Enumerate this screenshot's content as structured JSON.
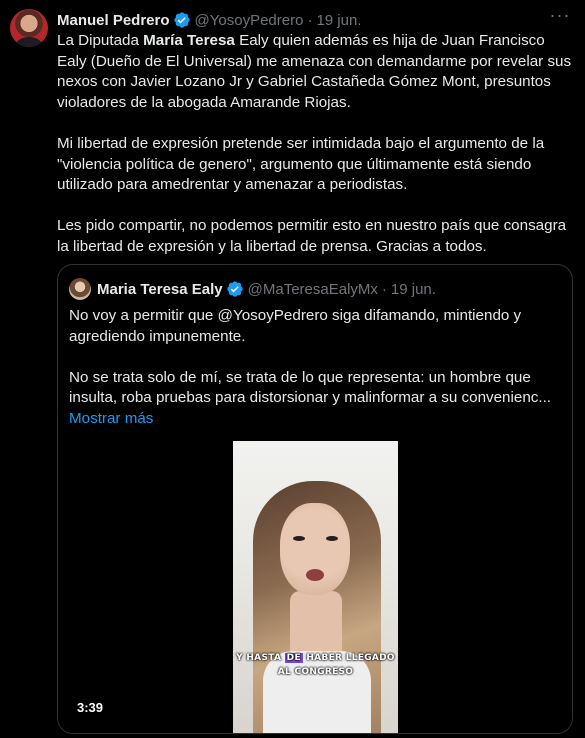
{
  "tweet": {
    "author": {
      "name": "Manuel Pedrero",
      "handle": "@YosoyPedrero",
      "date": "19 jun.",
      "separator": "·"
    },
    "more_label": "···",
    "paragraph1": {
      "t1": "La Diputada ",
      "bold1": "María Teresa",
      "t2": " Ealy quien además es hija de Juan Francisco Ealy (Dueño de El Universal) me amenaza con demandarme por revelar sus nexos con Javier Lozano Jr y Gabriel Castañeda Gómez Mont, presuntos violadores de la abogada Amarande Riojas."
    },
    "paragraph2": "Mi libertad de expresión pretende ser intimidada bajo el argumento de la \"violencia política de genero\", argumento que últimamente está siendo utilizado para amedrentar y amenazar a periodistas.",
    "paragraph3": "Les pido compartir, no podemos permitir esto en nuestro país que consagra la libertad de expresión y la libertad de prensa. Gracias a todos."
  },
  "quote": {
    "author": {
      "name": "Maria Teresa Ealy",
      "handle": "@MaTeresaEalyMx",
      "date": "19 jun.",
      "separator": "·"
    },
    "paragraph1": "No voy a permitir que @YosoyPedrero siga difamando, mintiendo y agrediendo impunemente.",
    "paragraph2": "No se trata solo de mí, se trata de lo que representa: un hombre que insulta, roba pruebas para distorsionar y malinformar a su convenienc...",
    "show_more": "Mostrar más",
    "video": {
      "caption_pre": "Y HASTA ",
      "caption_hl": "DE",
      "caption_post": " HABER LLEGADO",
      "caption_line2": "AL CONGRESO",
      "duration": "3:39"
    }
  },
  "colors": {
    "background": "#000000",
    "text": "#e7e9ea",
    "secondary": "#71767b",
    "link": "#1d9bf0",
    "verified": "#1d9bf0",
    "border": "#2f3336"
  },
  "icons": [
    "avatar",
    "verified-badge-icon",
    "more-options-icon"
  ]
}
